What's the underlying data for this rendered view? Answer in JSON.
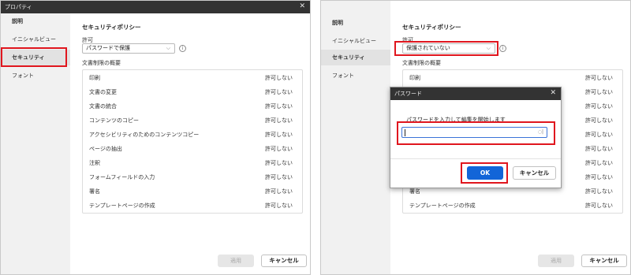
{
  "left": {
    "title": "プロパティ",
    "sidebar": {
      "items": [
        {
          "label": "説明"
        },
        {
          "label": "イニシャルビュー"
        },
        {
          "label": "セキュリティ"
        },
        {
          "label": "フォント"
        }
      ]
    },
    "section_title": "セキュリティポリシー",
    "permission_label": "許可",
    "permission_value": "パスワードで保護",
    "summary_title": "文書制限の概要",
    "rows": [
      {
        "name": "印刷",
        "value": "許可しない"
      },
      {
        "name": "文書の変更",
        "value": "許可しない"
      },
      {
        "name": "文書の統合",
        "value": "許可しない"
      },
      {
        "name": "コンテンツのコピー",
        "value": "許可しない"
      },
      {
        "name": "アクセシビリティのためのコンテンツコピー",
        "value": "許可しない"
      },
      {
        "name": "ページの抽出",
        "value": "許可しない"
      },
      {
        "name": "注釈",
        "value": "許可しない"
      },
      {
        "name": "フォームフィールドの入力",
        "value": "許可しない"
      },
      {
        "name": "署名",
        "value": "許可しない"
      },
      {
        "name": "テンプレートページの作成",
        "value": "許可しない"
      }
    ],
    "apply_label": "適用",
    "cancel_label": "キャンセル"
  },
  "right": {
    "sidebar": {
      "items": [
        {
          "label": "説明"
        },
        {
          "label": "イニシャルビュー"
        },
        {
          "label": "セキュリティ"
        },
        {
          "label": "フォント"
        }
      ]
    },
    "section_title": "セキュリティポリシー",
    "permission_label": "許可",
    "permission_value": "保護されていない",
    "summary_title": "文書制限の概要",
    "rows": [
      {
        "name": "印刷",
        "value": "許可しない"
      },
      {
        "name": "署名",
        "value": "許可しない"
      },
      {
        "name": "テンプレートページの作成",
        "value": "許可しない"
      }
    ],
    "apply_label": "適用",
    "cancel_label": "キャンセル"
  },
  "password_dialog": {
    "title": "パスワード",
    "message": "パスワードを入力して編集を開始します",
    "ok_label": "OK",
    "cancel_label": "キャンセル"
  },
  "colors": {
    "highlight": "#e0161e",
    "titlebar": "#333333",
    "ok_button": "#1265d8"
  },
  "icons": [
    "close-icon",
    "chevron-down-icon",
    "info-icon",
    "eye-toggle-icon"
  ]
}
